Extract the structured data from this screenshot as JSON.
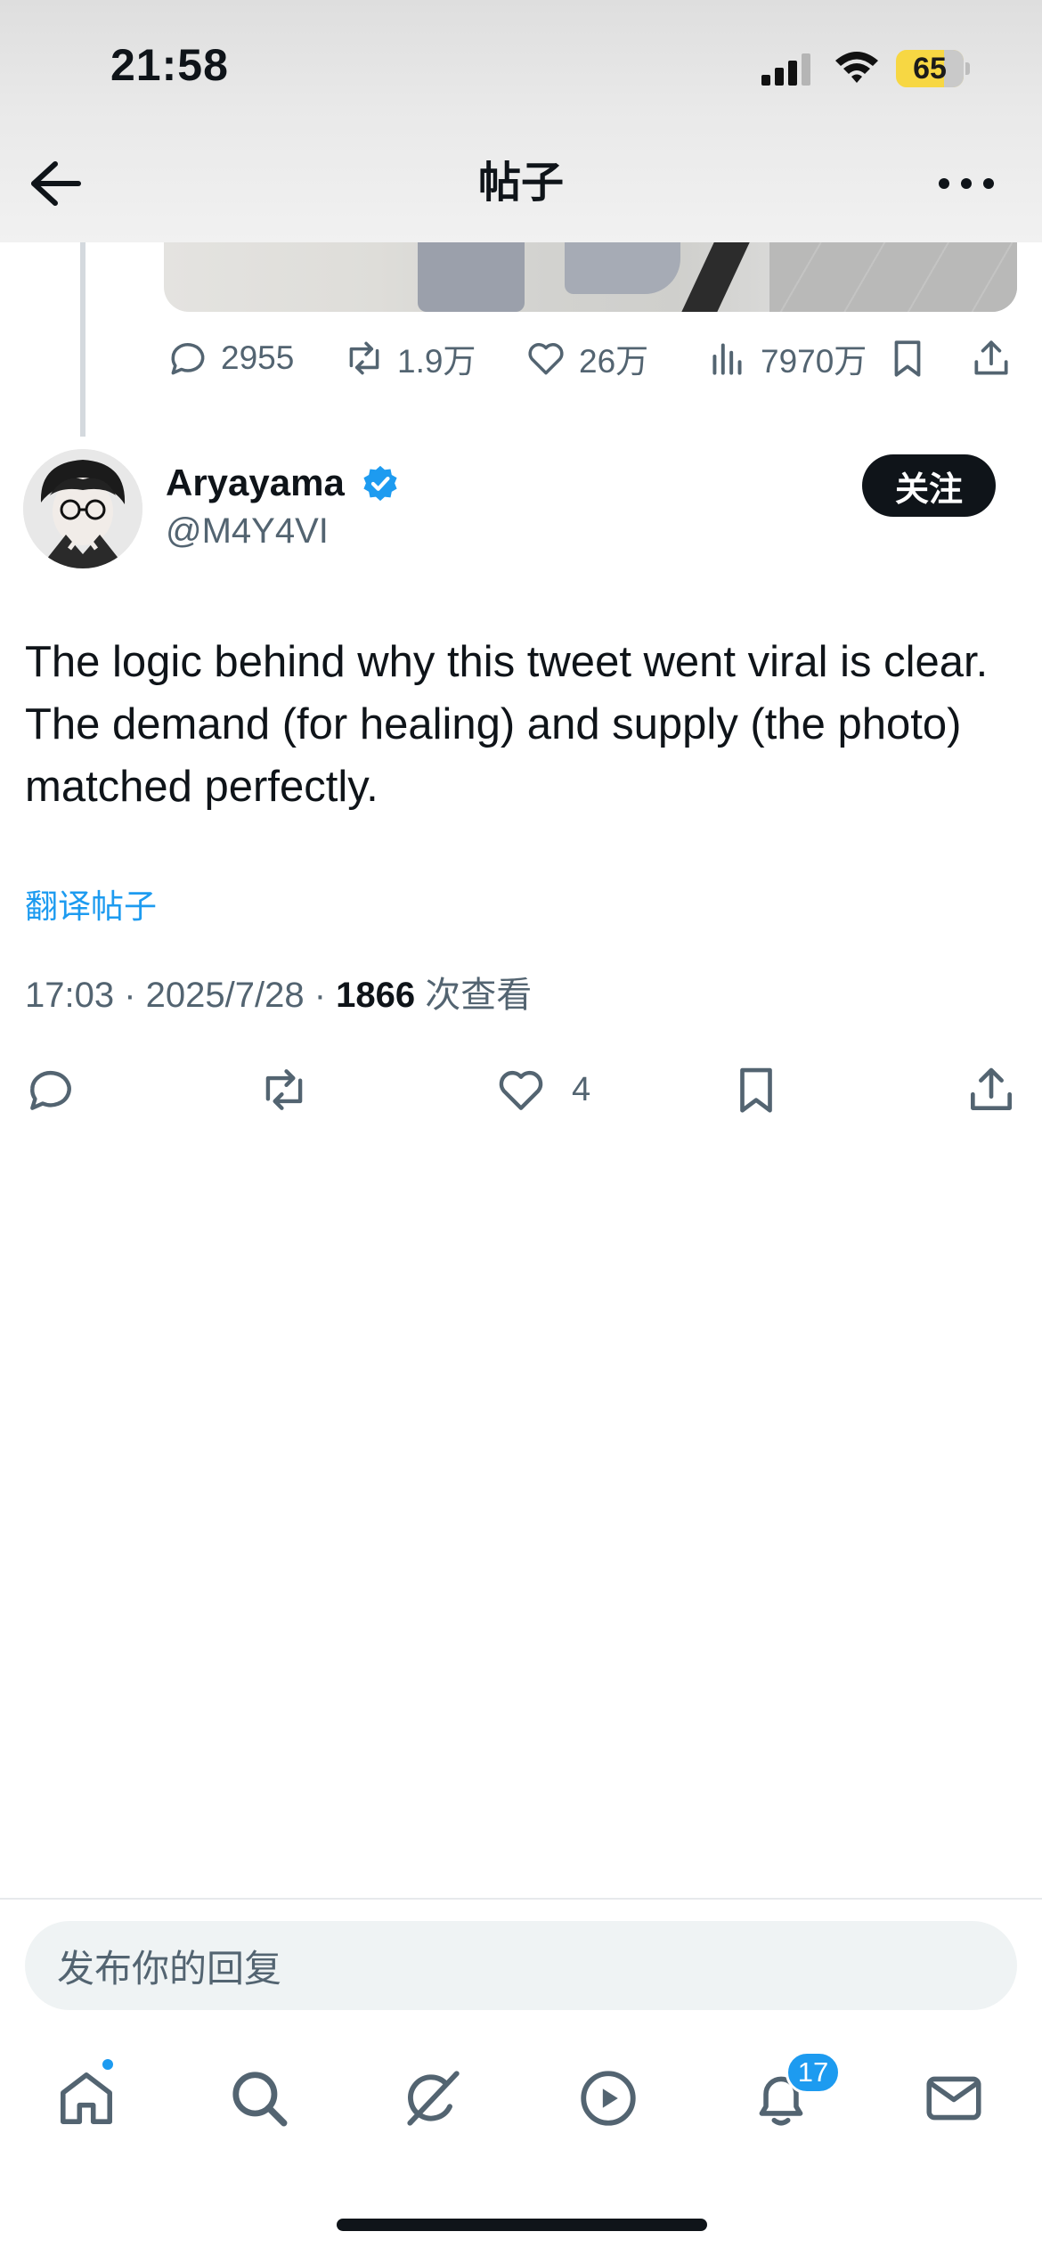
{
  "status_bar": {
    "time": "21:58",
    "battery_level": "65",
    "battery_color": "#f7d743"
  },
  "nav": {
    "title": "帖子",
    "back_icon": "arrow-left-icon",
    "more_icon": "more-horizontal-icon"
  },
  "parent_tweet": {
    "stats": {
      "replies": "2955",
      "reposts": "1.9万",
      "likes": "26万",
      "views": "7970万"
    }
  },
  "tweet": {
    "author": {
      "display_name": "Aryayama",
      "handle": "@M4Y4VI",
      "verified": true
    },
    "follow_label": "关注",
    "text": "The logic behind why this tweet went viral is clear. The demand (for healing) and supply (the photo) matched perfectly.",
    "translate_label": "翻译帖子",
    "timestamp": "17:03 · 2025/7/28 · ",
    "view_count": "1866",
    "view_label": " 次查看",
    "actions": {
      "likes": "4"
    }
  },
  "reply": {
    "placeholder": "发布你的回复"
  },
  "tab_bar": {
    "items": [
      "home-icon",
      "search-icon",
      "grok-icon",
      "video-icon",
      "notifications-icon",
      "messages-icon"
    ],
    "notification_badge": "17"
  },
  "colors": {
    "accent": "#1d9bf0",
    "text_primary": "#0f1419",
    "text_secondary": "#536471"
  }
}
